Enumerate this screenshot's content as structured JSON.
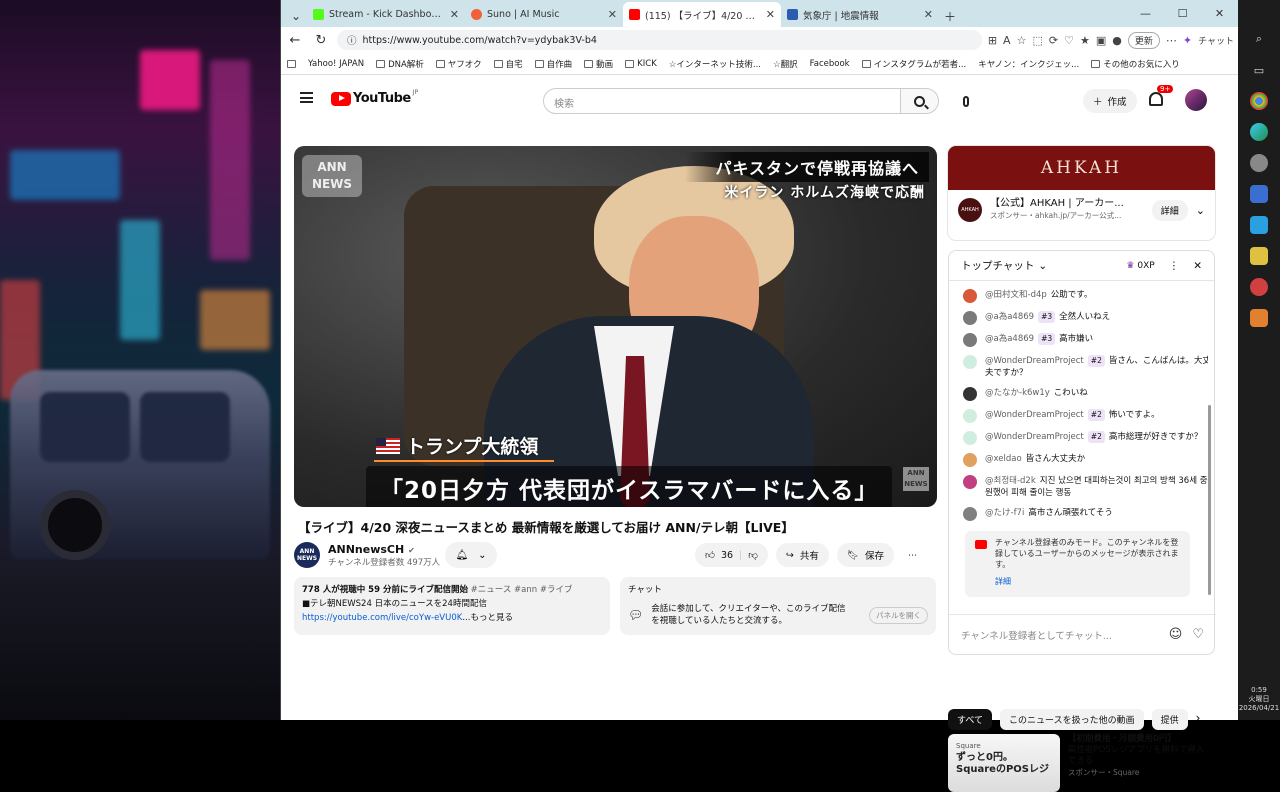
{
  "tabs": [
    {
      "label": "Stream - Kick Dashboard",
      "color": "#53fc18"
    },
    {
      "label": "Suno | AI Music",
      "color": "#f0603a"
    },
    {
      "label": "(115) 【ライブ】4/20 深夜ニュースまとめ",
      "color": "#ff0000"
    },
    {
      "label": "気象庁 | 地震情報",
      "color": "#2a5db0"
    }
  ],
  "address": {
    "url": "https://www.youtube.com/watch?v=ydybak3V-b4",
    "update_label": "更新",
    "chat_label": "チャット"
  },
  "bookmarks": [
    "Yahoo! JAPAN",
    "DNA解析",
    "ヤフオク",
    "自宅",
    "自作曲",
    "動画",
    "KICK",
    "☆インターネット技術...",
    "☆翻訳",
    "Facebook",
    "インスタグラムが若者...",
    "キヤノン：インクジェッ...",
    "その他のお気に入り"
  ],
  "yt": {
    "logo": "YouTube",
    "logo_region": "JP",
    "search_placeholder": "検索",
    "create_label": "作成",
    "notif_badge": "9+"
  },
  "video": {
    "ann_logo": "ANN NEWS",
    "caption_top": "パキスタンで停戦再協議へ",
    "caption_sub": "米イラン ホルムズ海峡で応酬",
    "name_plate": "トランプ大統領",
    "main_caption": "「20日夕方 代表団がイスラマバードに入る」",
    "small_logo": "ANN NEWS"
  },
  "title": "【ライブ】4/20 深夜ニュースまとめ 最新情報を厳選してお届け ANN/テレ朝【LIVE】",
  "channel": {
    "avatar_text": "ANN NEWS",
    "name": "ANNnewsCH",
    "subs": "チャンネル登録者数 497万人"
  },
  "actions": {
    "likes": "36",
    "share": "共有",
    "save": "保存"
  },
  "description": {
    "line1_bold": "778 人が視聴中  59 分前にライブ配信開始",
    "line1_tags": " #ニュース #ann #ライブ",
    "line2": "■テレ朝NEWS24 日本のニュースを24時間配信",
    "link": "https://youtube.com/live/coYw-eVU0K",
    "more": "...もっと見る"
  },
  "chat_panel": {
    "title": "チャット",
    "body": "会話に参加して、クリエイターや、このライブ配信を視聴している人たちと交流する。",
    "open": "パネルを開く"
  },
  "ad": {
    "banner": "AHKAH",
    "logo_text": "AHKAH",
    "title": "【公式】AHKAH | アーカー...",
    "sponsor": "スポンサー・ahkah.jp/アーカー公式...",
    "button": "詳細"
  },
  "live_chat": {
    "header": "トップチャット",
    "xp": "0XP",
    "messages": [
      {
        "author": "@田村文和-d4p",
        "badge": "",
        "text": "公助です。",
        "color": "#d9583a"
      },
      {
        "author": "@a為a4869",
        "badge": "#3",
        "text": "全然人いねえ",
        "color": "#7a7a7a"
      },
      {
        "author": "@a為a4869",
        "badge": "#3",
        "text": "高市嫌い",
        "color": "#7a7a7a"
      },
      {
        "author": "@WonderDreamProject",
        "badge": "#2",
        "text": "皆さん、こんばんは。大丈夫ですか？",
        "color": "#cfeee0"
      },
      {
        "author": "@たなか-k6w1y",
        "badge": "",
        "text": "こわいね",
        "color": "#333333"
      },
      {
        "author": "@WonderDreamProject",
        "badge": "#2",
        "text": "怖いですよ。",
        "color": "#cfeee0"
      },
      {
        "author": "@WonderDreamProject",
        "badge": "#2",
        "text": "高市総理が好きですか？",
        "color": "#cfeee0"
      },
      {
        "author": "@xeldao",
        "badge": "",
        "text": "皆さん大丈夫か",
        "color": "#e0a060"
      },
      {
        "author": "@최정태-d2k",
        "badge": "",
        "text": "지진 났으면 대피하는것이 최고의 방책 36세 중원했어 피해 줄이는 행동",
        "color": "#c04080"
      },
      {
        "author": "@たけ-f7i",
        "badge": "",
        "text": "高市さん頑張れてそう",
        "color": "#808080"
      }
    ],
    "notice": "チャンネル登録者のみモード。このチャンネルを登録しているユーザーからのメッセージが表示されます。",
    "notice_link": "詳細",
    "input_placeholder": "チャンネル登録者としてチャット..."
  },
  "chips": [
    "すべて",
    "このニュースを扱った他の動画",
    "提供"
  ],
  "rec": {
    "thumb_brand": "Square",
    "thumb_line1": "ずっと0円。",
    "thumb_line2": "SquareのPOSレジ",
    "title": "【初期費用・月額費用0円】",
    "desc": "高性能POSレジアプリを無料で導入できる",
    "sponsor": "スポンサー・Square"
  },
  "clock": {
    "time": "0:59",
    "day": "火曜日",
    "date": "2026/04/21"
  }
}
